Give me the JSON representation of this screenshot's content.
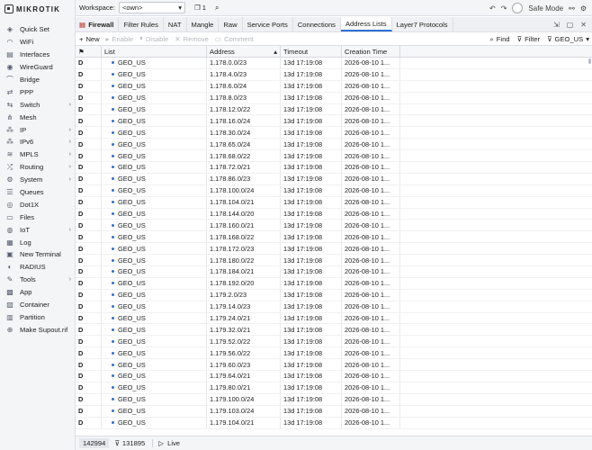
{
  "brand": {
    "logo_text": "MIKROTIK"
  },
  "sidebar": {
    "items": [
      {
        "label": "Quick Set",
        "icon": "quick-set-icon",
        "glyph": "◈",
        "chevron": false
      },
      {
        "label": "WiFi",
        "icon": "wifi-icon",
        "glyph": "◠",
        "chevron": false
      },
      {
        "label": "Interfaces",
        "icon": "interfaces-icon",
        "glyph": "▤",
        "chevron": false
      },
      {
        "label": "WireGuard",
        "icon": "wireguard-icon",
        "glyph": "◉",
        "chevron": false
      },
      {
        "label": "Bridge",
        "icon": "bridge-icon",
        "glyph": "⌒",
        "chevron": false
      },
      {
        "label": "PPP",
        "icon": "ppp-icon",
        "glyph": "⇄",
        "chevron": false
      },
      {
        "label": "Switch",
        "icon": "switch-icon",
        "glyph": "⇆",
        "chevron": true
      },
      {
        "label": "Mesh",
        "icon": "mesh-icon",
        "glyph": "⋔",
        "chevron": false
      },
      {
        "label": "IP",
        "icon": "ip-icon",
        "glyph": "⁂",
        "chevron": true
      },
      {
        "label": "IPv6",
        "icon": "ipv6-icon",
        "glyph": "⁂",
        "chevron": true
      },
      {
        "label": "MPLS",
        "icon": "mpls-icon",
        "glyph": "≋",
        "chevron": true
      },
      {
        "label": "Routing",
        "icon": "routing-icon",
        "glyph": "⤮",
        "chevron": true
      },
      {
        "label": "System",
        "icon": "system-icon",
        "glyph": "⚙",
        "chevron": true
      },
      {
        "label": "Queues",
        "icon": "queues-icon",
        "glyph": "☰",
        "chevron": false
      },
      {
        "label": "Dot1X",
        "icon": "dot1x-icon",
        "glyph": "◎",
        "chevron": false
      },
      {
        "label": "Files",
        "icon": "files-icon",
        "glyph": "▭",
        "chevron": false
      },
      {
        "label": "IoT",
        "icon": "iot-icon",
        "glyph": "◍",
        "chevron": true
      },
      {
        "label": "Log",
        "icon": "log-icon",
        "glyph": "▦",
        "chevron": false
      },
      {
        "label": "New Terminal",
        "icon": "terminal-icon",
        "glyph": "▣",
        "chevron": false
      },
      {
        "label": "RADIUS",
        "icon": "radius-icon",
        "glyph": "◐",
        "chevron": false
      },
      {
        "label": "Tools",
        "icon": "tools-icon",
        "glyph": "✎",
        "chevron": true
      },
      {
        "label": "App",
        "icon": "app-icon",
        "glyph": "▩",
        "chevron": false
      },
      {
        "label": "Container",
        "icon": "container-icon",
        "glyph": "▧",
        "chevron": false
      },
      {
        "label": "Partition",
        "icon": "partition-icon",
        "glyph": "▥",
        "chevron": false
      },
      {
        "label": "Make Supout.rif",
        "icon": "supout-icon",
        "glyph": "⊕",
        "chevron": false
      }
    ]
  },
  "topbar": {
    "workspace_label": "Workspace:",
    "workspace_value": "<own>",
    "windows_count": "1",
    "safe_mode_label": "Safe Mode"
  },
  "tabs": {
    "section": "Firewall",
    "items": [
      "Filter Rules",
      "NAT",
      "Mangle",
      "Raw",
      "Service Ports",
      "Connections",
      "Address Lists",
      "Layer7 Protocols"
    ],
    "active": "Address Lists"
  },
  "toolbar": {
    "new": "New",
    "enable": "Enable",
    "disable": "Disable",
    "remove": "Remove",
    "comment": "Comment",
    "find": "Find",
    "filter": "Filter",
    "filter_value": "GEO_US"
  },
  "table": {
    "columns": [
      "List",
      "Address",
      "Timeout",
      "Creation Time"
    ],
    "rows": [
      {
        "flag": "D",
        "list": "GEO_US",
        "address": "1.178.0.0/23",
        "timeout": "13d 17:19:08",
        "created": "2026-08-10 1..."
      },
      {
        "flag": "D",
        "list": "GEO_US",
        "address": "1.178.4.0/23",
        "timeout": "13d 17:19:08",
        "created": "2026-08-10 1..."
      },
      {
        "flag": "D",
        "list": "GEO_US",
        "address": "1.178.6.0/24",
        "timeout": "13d 17:19:08",
        "created": "2026-08-10 1..."
      },
      {
        "flag": "D",
        "list": "GEO_US",
        "address": "1.178.8.0/23",
        "timeout": "13d 17:19:08",
        "created": "2026-08-10 1..."
      },
      {
        "flag": "D",
        "list": "GEO_US",
        "address": "1.178.12.0/22",
        "timeout": "13d 17:19:08",
        "created": "2026-08-10 1..."
      },
      {
        "flag": "D",
        "list": "GEO_US",
        "address": "1.178.16.0/24",
        "timeout": "13d 17:19:08",
        "created": "2026-08-10 1..."
      },
      {
        "flag": "D",
        "list": "GEO_US",
        "address": "1.178.30.0/24",
        "timeout": "13d 17:19:08",
        "created": "2026-08-10 1..."
      },
      {
        "flag": "D",
        "list": "GEO_US",
        "address": "1.178.65.0/24",
        "timeout": "13d 17:19:08",
        "created": "2026-08-10 1..."
      },
      {
        "flag": "D",
        "list": "GEO_US",
        "address": "1.178.68.0/22",
        "timeout": "13d 17:19:08",
        "created": "2026-08-10 1..."
      },
      {
        "flag": "D",
        "list": "GEO_US",
        "address": "1.178.72.0/21",
        "timeout": "13d 17:19:08",
        "created": "2026-08-10 1..."
      },
      {
        "flag": "D",
        "list": "GEO_US",
        "address": "1.178.86.0/23",
        "timeout": "13d 17:19:08",
        "created": "2026-08-10 1..."
      },
      {
        "flag": "D",
        "list": "GEO_US",
        "address": "1.178.100.0/24",
        "timeout": "13d 17:19:08",
        "created": "2026-08-10 1..."
      },
      {
        "flag": "D",
        "list": "GEO_US",
        "address": "1.178.104.0/21",
        "timeout": "13d 17:19:08",
        "created": "2026-08-10 1..."
      },
      {
        "flag": "D",
        "list": "GEO_US",
        "address": "1.178.144.0/20",
        "timeout": "13d 17:19:08",
        "created": "2026-08-10 1..."
      },
      {
        "flag": "D",
        "list": "GEO_US",
        "address": "1.178.160.0/21",
        "timeout": "13d 17:19:08",
        "created": "2026-08-10 1..."
      },
      {
        "flag": "D",
        "list": "GEO_US",
        "address": "1.178.168.0/22",
        "timeout": "13d 17:19:08",
        "created": "2026-08-10 1..."
      },
      {
        "flag": "D",
        "list": "GEO_US",
        "address": "1.178.172.0/23",
        "timeout": "13d 17:19:08",
        "created": "2026-08-10 1..."
      },
      {
        "flag": "D",
        "list": "GEO_US",
        "address": "1.178.180.0/22",
        "timeout": "13d 17:19:08",
        "created": "2026-08-10 1..."
      },
      {
        "flag": "D",
        "list": "GEO_US",
        "address": "1.178.184.0/21",
        "timeout": "13d 17:19:08",
        "created": "2026-08-10 1..."
      },
      {
        "flag": "D",
        "list": "GEO_US",
        "address": "1.178.192.0/20",
        "timeout": "13d 17:19:08",
        "created": "2026-08-10 1..."
      },
      {
        "flag": "D",
        "list": "GEO_US",
        "address": "1.179.2.0/23",
        "timeout": "13d 17:19:08",
        "created": "2026-08-10 1..."
      },
      {
        "flag": "D",
        "list": "GEO_US",
        "address": "1.179.14.0/23",
        "timeout": "13d 17:19:08",
        "created": "2026-08-10 1..."
      },
      {
        "flag": "D",
        "list": "GEO_US",
        "address": "1.179.24.0/21",
        "timeout": "13d 17:19:08",
        "created": "2026-08-10 1..."
      },
      {
        "flag": "D",
        "list": "GEO_US",
        "address": "1.179.32.0/21",
        "timeout": "13d 17:19:08",
        "created": "2026-08-10 1..."
      },
      {
        "flag": "D",
        "list": "GEO_US",
        "address": "1.179.52.0/22",
        "timeout": "13d 17:19:08",
        "created": "2026-08-10 1..."
      },
      {
        "flag": "D",
        "list": "GEO_US",
        "address": "1.179.56.0/22",
        "timeout": "13d 17:19:08",
        "created": "2026-08-10 1..."
      },
      {
        "flag": "D",
        "list": "GEO_US",
        "address": "1.179.60.0/23",
        "timeout": "13d 17:19:08",
        "created": "2026-08-10 1..."
      },
      {
        "flag": "D",
        "list": "GEO_US",
        "address": "1.179.64.0/21",
        "timeout": "13d 17:19:08",
        "created": "2026-08-10 1..."
      },
      {
        "flag": "D",
        "list": "GEO_US",
        "address": "1.179.80.0/21",
        "timeout": "13d 17:19:08",
        "created": "2026-08-10 1..."
      },
      {
        "flag": "D",
        "list": "GEO_US",
        "address": "1.179.100.0/24",
        "timeout": "13d 17:19:08",
        "created": "2026-08-10 1..."
      },
      {
        "flag": "D",
        "list": "GEO_US",
        "address": "1.179.103.0/24",
        "timeout": "13d 17:19:08",
        "created": "2026-08-10 1..."
      },
      {
        "flag": "D",
        "list": "GEO_US",
        "address": "1.179.104.0/21",
        "timeout": "13d 17:19:08",
        "created": "2026-08-10 1..."
      }
    ]
  },
  "status": {
    "total": "142994",
    "filtered": "131895",
    "live_label": "Live"
  },
  "colors": {
    "accent": "#2f6fd3",
    "sidebar_bg": "#f4f5f7"
  }
}
